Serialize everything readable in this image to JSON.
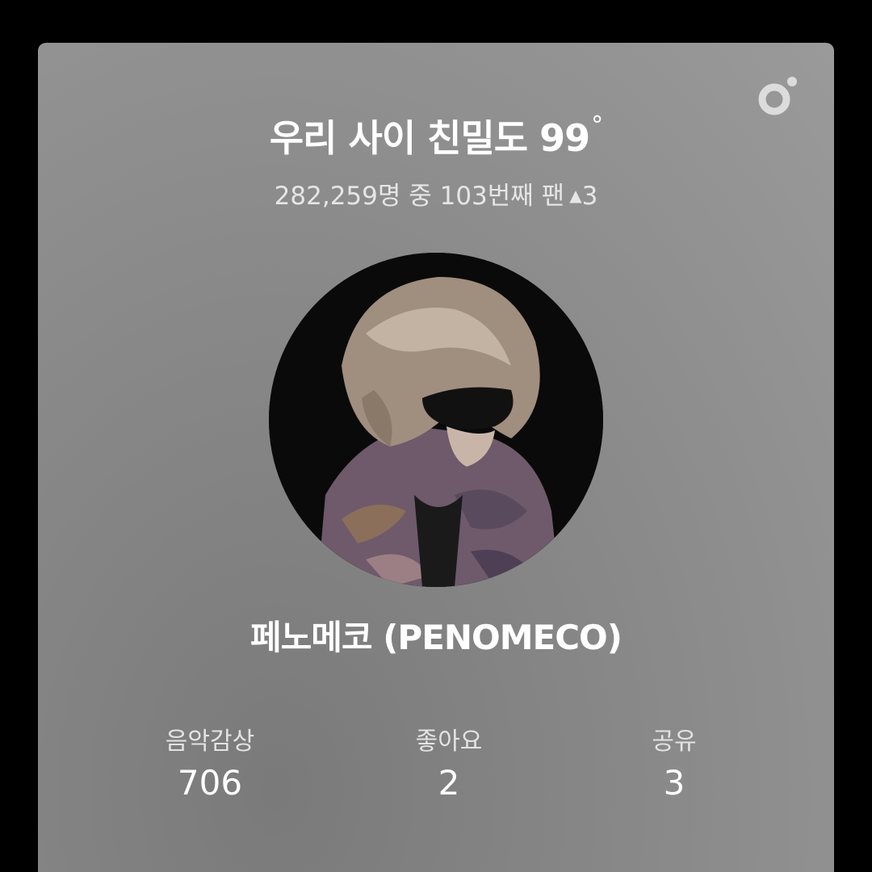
{
  "card": {
    "title": "우리 사이 친밀도 99",
    "degree_symbol": "°",
    "rank_text": "282,259명 중 103번째 팬",
    "rank_change_arrow": "▲",
    "rank_change": "3",
    "artist_name": "페노메코 (PENOMECO)",
    "brand_icon": "flo-logo-icon"
  },
  "stats": [
    {
      "label": "음악감상",
      "value": "706"
    },
    {
      "label": "좋아요",
      "value": "2"
    },
    {
      "label": "공유",
      "value": "3"
    }
  ],
  "colors": {
    "page_background": "#000000",
    "card_background": "#8c8c8c",
    "text_primary": "#ffffff",
    "text_secondary": "#e6e6e6"
  }
}
